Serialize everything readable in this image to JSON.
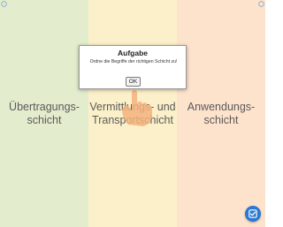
{
  "columns": [
    {
      "label": "Übertragungs-\nschicht",
      "color": "#e3eccd"
    },
    {
      "label": "Vermittlungs- und\nTransportschicht",
      "color": "#fbf0c9"
    },
    {
      "label": "Anwendungs-\nschicht",
      "color": "#fde2cc"
    }
  ],
  "dialog": {
    "title": "Aufgabe",
    "message": "Ordne die Begriffe der richtigen Schicht zu!",
    "ok_label": "OK"
  },
  "icons": {
    "hand": "pointing-hand-icon",
    "check_button": "check-icon",
    "corner": "info-icon"
  },
  "accent": "#2b78d3"
}
